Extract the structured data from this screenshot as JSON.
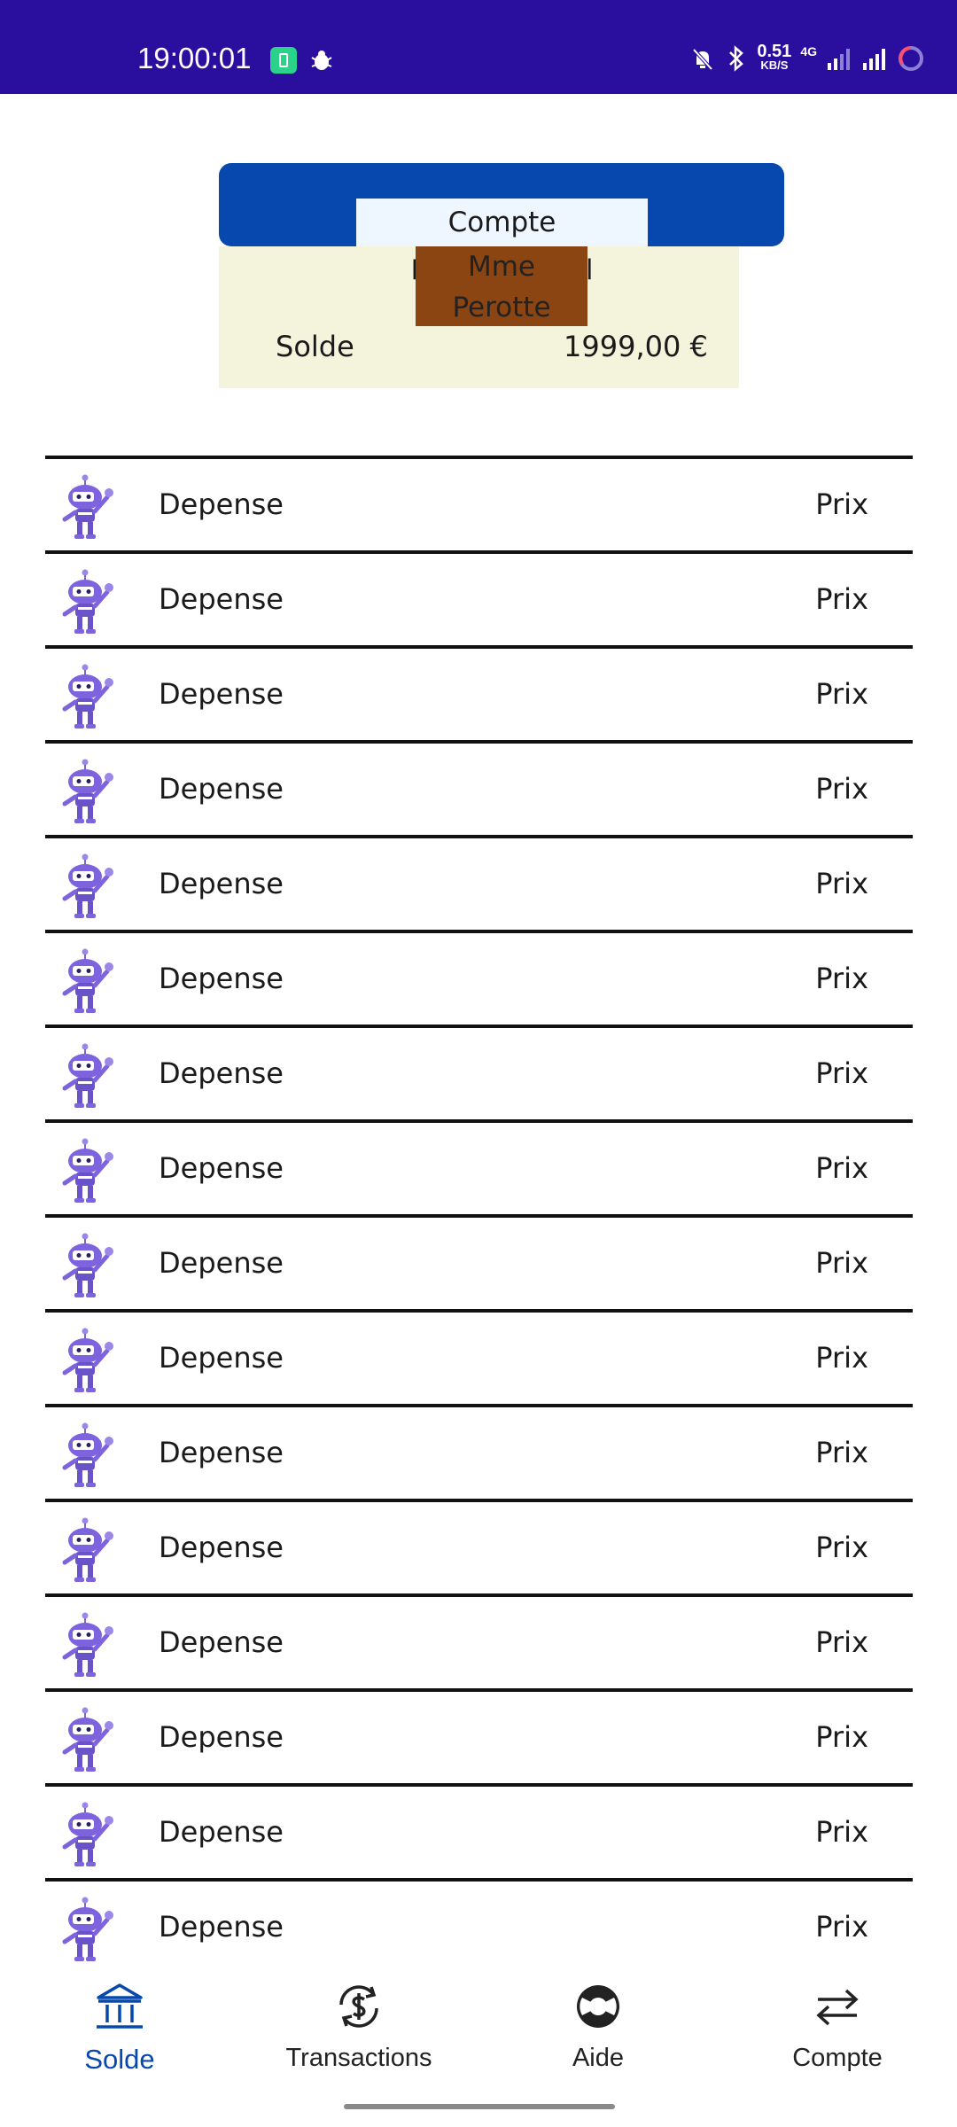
{
  "status_bar": {
    "time": "19:00:01",
    "net_speed": "0.51",
    "net_speed_unit": "KB/S",
    "network_type": "4G"
  },
  "account": {
    "title": "Compte Professionnel",
    "owner": "Mme Perotte",
    "balance_label": "Solde",
    "balance_value": "1999,00 €"
  },
  "transactions": [
    {
      "label": "Depense",
      "price": "Prix"
    },
    {
      "label": "Depense",
      "price": "Prix"
    },
    {
      "label": "Depense",
      "price": "Prix"
    },
    {
      "label": "Depense",
      "price": "Prix"
    },
    {
      "label": "Depense",
      "price": "Prix"
    },
    {
      "label": "Depense",
      "price": "Prix"
    },
    {
      "label": "Depense",
      "price": "Prix"
    },
    {
      "label": "Depense",
      "price": "Prix"
    },
    {
      "label": "Depense",
      "price": "Prix"
    },
    {
      "label": "Depense",
      "price": "Prix"
    },
    {
      "label": "Depense",
      "price": "Prix"
    },
    {
      "label": "Depense",
      "price": "Prix"
    },
    {
      "label": "Depense",
      "price": "Prix"
    },
    {
      "label": "Depense",
      "price": "Prix"
    },
    {
      "label": "Depense",
      "price": "Prix"
    },
    {
      "label": "Depense",
      "price": "Prix"
    }
  ],
  "bottom_nav": [
    {
      "label": "Solde",
      "icon": "bank-icon",
      "active": true
    },
    {
      "label": "Transactions",
      "icon": "dollar-sync-icon",
      "active": false
    },
    {
      "label": "Aide",
      "icon": "lifebuoy-icon",
      "active": false
    },
    {
      "label": "Compte",
      "icon": "swap-arrows-icon",
      "active": false
    }
  ],
  "colors": {
    "status_bar": "#2a0f9e",
    "card_header": "#0648ad",
    "card_body": "#f4f4dc",
    "owner_bg": "#8b4513",
    "active_nav": "#0648ad"
  }
}
